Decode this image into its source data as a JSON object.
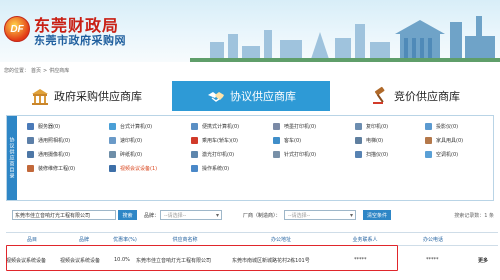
{
  "header": {
    "logo_text": "DF",
    "org_name": "东莞财政局",
    "org_subtitle": "东莞市政府采购网"
  },
  "breadcrumb": [
    "您的位置：",
    "首页",
    ">",
    "供应商库"
  ],
  "tabs": [
    {
      "label": "政府采购供应商库",
      "icon": "government-building-icon",
      "active": false
    },
    {
      "label": "协议供应商库",
      "icon": "handshake-icon",
      "active": true
    },
    {
      "label": "竞价供应商库",
      "icon": "gavel-icon",
      "active": false
    }
  ],
  "category_panel": {
    "side_label": "协议供应商目录",
    "items": [
      {
        "label": "服务器(0)",
        "icon": "server-icon",
        "color": "#4a7ab8"
      },
      {
        "label": "台式计算机(0)",
        "icon": "desktop-computer-icon",
        "color": "#4a9fd6"
      },
      {
        "label": "便携式计算机(0)",
        "icon": "laptop-icon",
        "color": "#5a8fc4"
      },
      {
        "label": "喷墨打印机(0)",
        "icon": "inkjet-printer-icon",
        "color": "#7b8aa6"
      },
      {
        "label": "复印机(0)",
        "icon": "copier-icon",
        "color": "#6c8db0"
      },
      {
        "label": "投影仪(0)",
        "icon": "projector-icon",
        "color": "#5b9ad0"
      },
      {
        "label": "通用照相机(0)",
        "icon": "camera-icon",
        "color": "#5c7fa8"
      },
      {
        "label": "速印机(0)",
        "icon": "duplicator-icon",
        "color": "#6a9ac8"
      },
      {
        "label": "乘用车(轿车)(0)",
        "icon": "car-icon",
        "color": "#d13a2a"
      },
      {
        "label": "客车(0)",
        "icon": "bus-icon",
        "color": "#3f8ec9"
      },
      {
        "label": "电梯(0)",
        "icon": "elevator-icon",
        "color": "#5f7f9f"
      },
      {
        "label": "家具用具(0)",
        "icon": "furniture-icon",
        "color": "#b4784a"
      },
      {
        "label": "通用摄像机(0)",
        "icon": "video-camera-icon",
        "color": "#4d77a6"
      },
      {
        "label": "碎纸机(0)",
        "icon": "shredder-icon",
        "color": "#6e8ea8"
      },
      {
        "label": "激光打印机(0)",
        "icon": "laser-printer-icon",
        "color": "#5e86ad"
      },
      {
        "label": "针式打印机(0)",
        "icon": "dot-matrix-printer-icon",
        "color": "#7890a8"
      },
      {
        "label": "扫描仪(0)",
        "icon": "scanner-icon",
        "color": "#5782b2"
      },
      {
        "label": "空调机(0)",
        "icon": "air-conditioner-icon",
        "color": "#5aa0d6"
      },
      {
        "label": "装修维修工程(0)",
        "icon": "renovation-icon",
        "color": "#c2683a"
      },
      {
        "label": "视频会议设备(1)",
        "icon": "video-conference-icon",
        "color": "#3d6fa8",
        "highlight": true
      },
      {
        "label": "操作系统(0)",
        "icon": "os-icon",
        "color": "#4a88c8"
      }
    ]
  },
  "search": {
    "keyword_value": "东莞市佳立音响灯光工程有限公司",
    "search_button": "搜索",
    "brand_label": "品牌：",
    "brand_select": "--请选择--",
    "vendor_label": "厂商（制造商）：",
    "vendor_select": "--请选择--",
    "clear_button": "清空条件",
    "record_count": "搜索记录数：1 条"
  },
  "table": {
    "headers": [
      "品目",
      "品牌",
      "优惠率(%)",
      "供应商名称",
      "办公地址",
      "业务联系人",
      "办公电话",
      ""
    ],
    "rows": [
      {
        "category": "视频会议系统设备",
        "brand": "视频会议系统设备",
        "discount": "10.0%",
        "supplier": "东莞市佳立音响灯光工程有限公司",
        "address": "东莞市南城区新城路花村2栋101号",
        "contact": "*****",
        "phone": "*****",
        "action": "更多"
      }
    ]
  }
}
